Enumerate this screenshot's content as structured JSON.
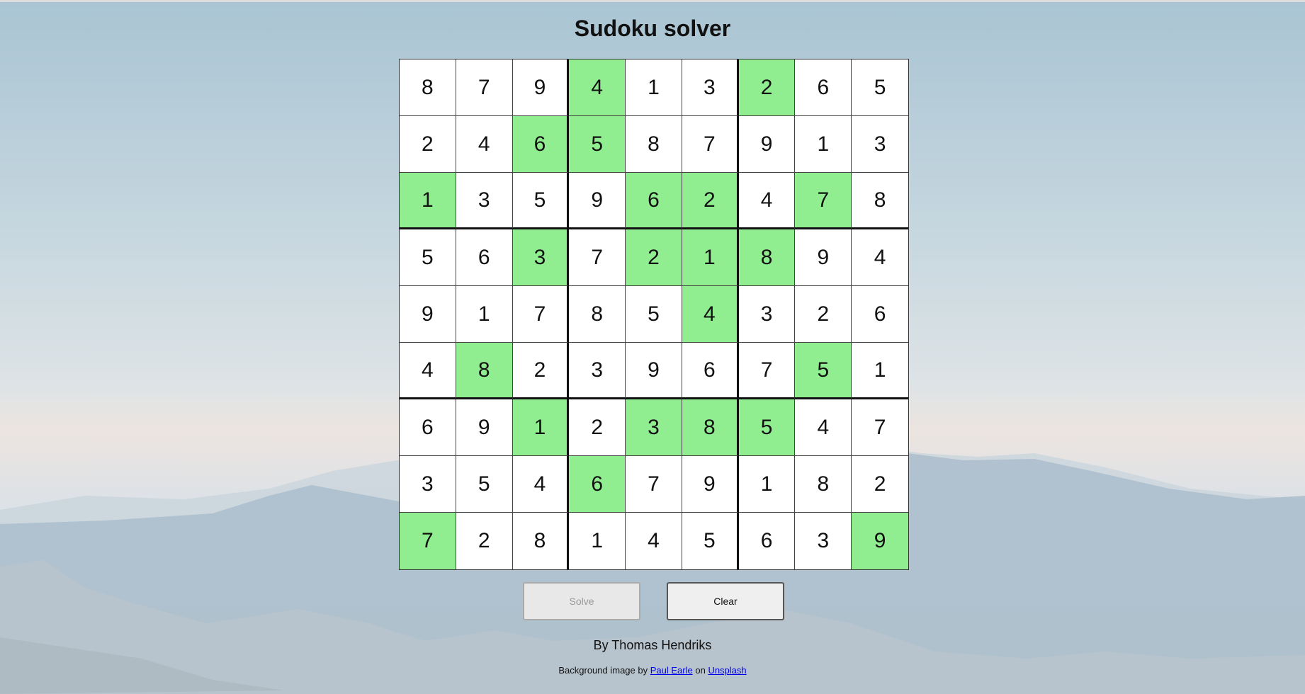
{
  "title": "Sudoku solver",
  "grid": [
    [
      8,
      7,
      9,
      4,
      1,
      3,
      2,
      6,
      5
    ],
    [
      2,
      4,
      6,
      5,
      8,
      7,
      9,
      1,
      3
    ],
    [
      1,
      3,
      5,
      9,
      6,
      2,
      4,
      7,
      8
    ],
    [
      5,
      6,
      3,
      7,
      2,
      1,
      8,
      9,
      4
    ],
    [
      9,
      1,
      7,
      8,
      5,
      4,
      3,
      2,
      6
    ],
    [
      4,
      8,
      2,
      3,
      9,
      6,
      7,
      5,
      1
    ],
    [
      6,
      9,
      1,
      2,
      3,
      8,
      5,
      4,
      7
    ],
    [
      3,
      5,
      4,
      6,
      7,
      9,
      1,
      8,
      2
    ],
    [
      7,
      2,
      8,
      1,
      4,
      5,
      6,
      3,
      9
    ]
  ],
  "highlighted": [
    [
      0,
      3
    ],
    [
      0,
      6
    ],
    [
      1,
      2
    ],
    [
      1,
      3
    ],
    [
      2,
      0
    ],
    [
      2,
      4
    ],
    [
      2,
      5
    ],
    [
      2,
      7
    ],
    [
      3,
      2
    ],
    [
      3,
      4
    ],
    [
      3,
      5
    ],
    [
      3,
      6
    ],
    [
      4,
      5
    ],
    [
      5,
      1
    ],
    [
      5,
      7
    ],
    [
      6,
      2
    ],
    [
      6,
      4
    ],
    [
      6,
      5
    ],
    [
      6,
      6
    ],
    [
      7,
      3
    ],
    [
      8,
      0
    ],
    [
      8,
      8
    ]
  ],
  "colors": {
    "highlight": "#90ee90",
    "cell": "#ffffff"
  },
  "buttons": {
    "solve_label": "Solve",
    "solve_disabled": true,
    "clear_label": "Clear"
  },
  "footer": {
    "author": "By Thomas Hendriks",
    "credit_prefix": "Background image by",
    "photographer": "Paul Earle",
    "credit_mid": "on",
    "site": "Unsplash"
  }
}
